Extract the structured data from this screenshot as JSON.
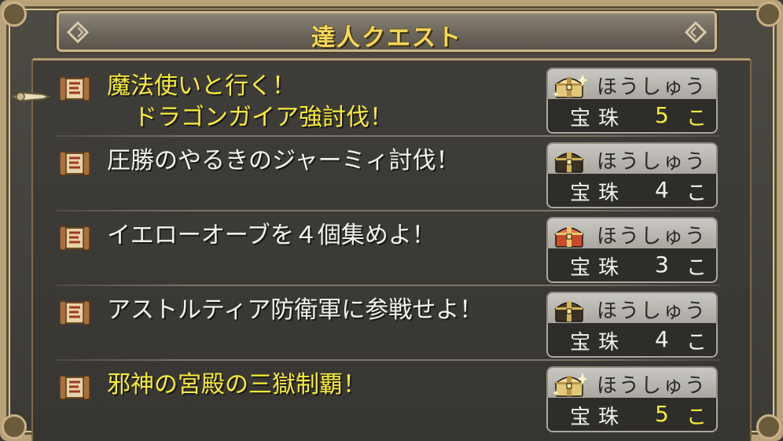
{
  "title": "達人クエスト",
  "quests": [
    {
      "name": "魔法使いと行く！",
      "name2": "ドラゴンガイア強討伐！",
      "special": true,
      "reward_label": "ほうしゅう",
      "item": "宝珠",
      "qty": "5",
      "unit": "こ",
      "chest": "gold-sparkle"
    },
    {
      "name": "圧勝のやるきのジャーミィ討伐！",
      "name2": "",
      "special": false,
      "reward_label": "ほうしゅう",
      "item": "宝珠",
      "qty": "4",
      "unit": "こ",
      "chest": "dark"
    },
    {
      "name": "イエローオーブを４個集めよ！",
      "name2": "",
      "special": false,
      "reward_label": "ほうしゅう",
      "item": "宝珠",
      "qty": "3",
      "unit": "こ",
      "chest": "red"
    },
    {
      "name": "アストルティア防衛軍に参戦せよ！",
      "name2": "",
      "special": false,
      "reward_label": "ほうしゅう",
      "item": "宝珠",
      "qty": "4",
      "unit": "こ",
      "chest": "dark"
    },
    {
      "name": "邪神の宮殿の三獄制覇！",
      "name2": "",
      "special": true,
      "reward_label": "ほうしゅう",
      "item": "宝珠",
      "qty": "5",
      "unit": "こ",
      "chest": "gold-sparkle"
    }
  ],
  "colors": {
    "accent": "#f6ea3a",
    "title": "#f4d65a",
    "text": "#f2f2ee",
    "panel": "#3a3a36"
  }
}
